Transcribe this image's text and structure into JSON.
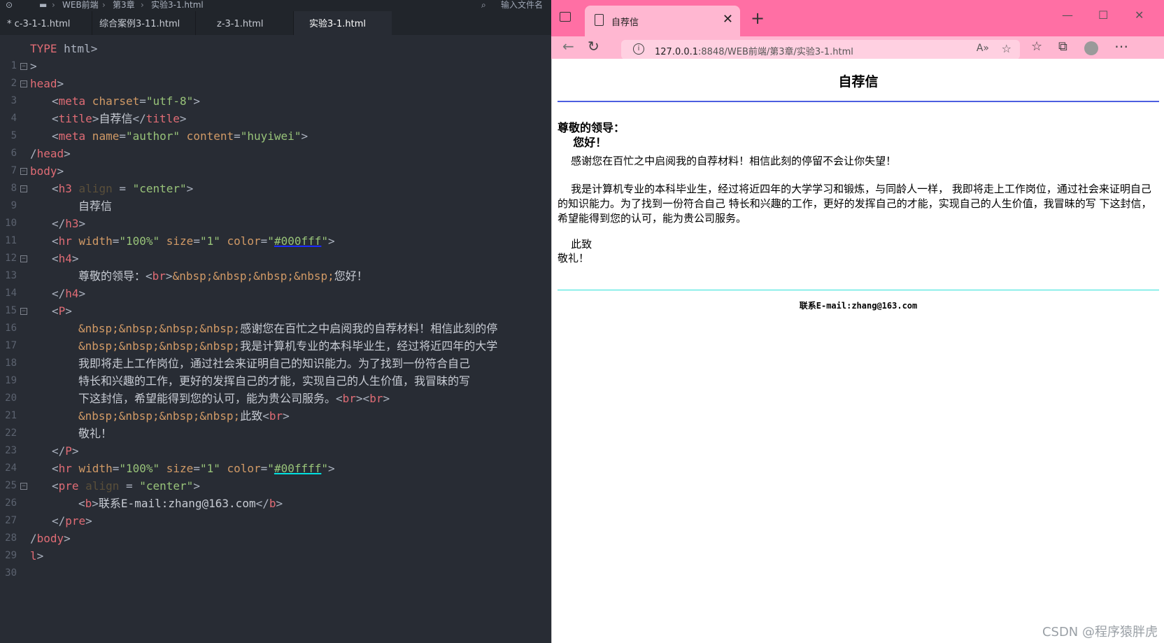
{
  "editor": {
    "breadcrumb": [
      "WEB前端",
      "第3章",
      "实验3-1.html"
    ],
    "search_placeholder": "输入文件名",
    "tabs": [
      {
        "label": "* c-3-1-1.html"
      },
      {
        "label": "综合案例3-11.html"
      },
      {
        "label": "z-3-1.html"
      },
      {
        "label": "实验3-1.html",
        "active": true
      }
    ],
    "line_numbers": [
      "1",
      "2",
      "3",
      "4",
      "5",
      "6",
      "7",
      "8",
      "9",
      "10",
      "11",
      "12",
      "13",
      "14",
      "15",
      "16",
      "17",
      "18",
      "19",
      "20",
      "21",
      "22",
      "23",
      "24",
      "25",
      "26",
      "27",
      "28",
      "29",
      "30"
    ],
    "lines": {
      "l1_a": "TYPE",
      "l1_b": " html>",
      "l2": ">",
      "l3_a": "head",
      "l3_b": ">",
      "l4_a": "<",
      "l4_b": "meta",
      "l4_c": " charset",
      "l4_d": "=",
      "l4_e": "\"utf-8\"",
      "l4_f": ">",
      "l5_a": "<",
      "l5_b": "title",
      "l5_c": ">",
      "l5_d": "自荐信",
      "l5_e": "</",
      "l5_f": "title",
      "l5_g": ">",
      "l6_a": "<",
      "l6_b": "meta",
      "l6_c": " name",
      "l6_d": "=",
      "l6_e": "\"author\"",
      "l6_f": " content",
      "l6_g": "=",
      "l6_h": "\"huyiwei\"",
      "l6_i": ">",
      "l7_a": "/",
      "l7_b": "head",
      "l7_c": ">",
      "l8_a": "body",
      "l8_b": ">",
      "l9_a": "<",
      "l9_b": "h3",
      "l9_c": " align",
      "l9_d": " = ",
      "l9_e": "\"center\"",
      "l9_f": ">",
      "l10": "自荐信",
      "l11_a": "</",
      "l11_b": "h3",
      "l11_c": ">",
      "l12_a": "<",
      "l12_b": "hr",
      "l12_c": " width",
      "l12_d": "=",
      "l12_e": "\"100%\"",
      "l12_f": " size",
      "l12_g": "=",
      "l12_h": "\"1\"",
      "l12_i": " color",
      "l12_j": "=",
      "l12_k": "\"",
      "l12_l": "#000fff",
      "l12_m": "\"",
      "l12_n": ">",
      "l13_a": "<",
      "l13_b": "h4",
      "l13_c": ">",
      "l14_a": "尊敬的领导：",
      "l14_b": "<",
      "l14_c": "br",
      "l14_d": ">",
      "l14_e": "&nbsp;&nbsp;&nbsp;&nbsp;",
      "l14_f": "您好！",
      "l15_a": "</",
      "l15_b": "h4",
      "l15_c": ">",
      "l16_a": "<",
      "l16_b": "P",
      "l16_c": ">",
      "l17_a": "&nbsp;&nbsp;&nbsp;&nbsp;",
      "l17_b": "感谢您在百忙之中启阅我的自荐材料！相信此刻的停",
      "l18_a": "&nbsp;&nbsp;&nbsp;&nbsp;",
      "l18_b": "我是计算机专业的本科毕业生，经过将近四年的大学",
      "l19": "我即将走上工作岗位，通过社会来证明自己的知识能力。为了找到一份符合自己",
      "l20": "特长和兴趣的工作，更好的发挥自己的才能，实现自己的人生价值，我冒昧的写",
      "l21_a": "下这封信，希望能得到您的认可，能为贵公司服务。",
      "l21_b": "<",
      "l21_c": "br",
      "l21_d": "><",
      "l21_e": "br",
      "l21_f": ">",
      "l22_a": "&nbsp;&nbsp;&nbsp;&nbsp;",
      "l22_b": "此致",
      "l22_c": "<",
      "l22_d": "br",
      "l22_e": ">",
      "l23": "敬礼！",
      "l24_a": "</",
      "l24_b": "P",
      "l24_c": ">",
      "l25_a": "<",
      "l25_b": "hr",
      "l25_c": " width",
      "l25_d": "=",
      "l25_e": "\"100%\"",
      "l25_f": " size",
      "l25_g": "=",
      "l25_h": "\"1\"",
      "l25_i": " color",
      "l25_j": "=",
      "l25_k": "\"",
      "l25_l": "#00ffff",
      "l25_m": "\"",
      "l25_n": ">",
      "l26_a": "<",
      "l26_b": "pre",
      "l26_c": " align",
      "l26_d": " = ",
      "l26_e": "\"center\"",
      "l26_f": ">",
      "l27_a": "<",
      "l27_b": "b",
      "l27_c": ">",
      "l27_d": "联系E-mail:zhang@163.com",
      "l27_e": "</",
      "l27_f": "b",
      "l27_g": ">",
      "l28_a": "</",
      "l28_b": "pre",
      "l28_c": ">",
      "l29_a": "/",
      "l29_b": "body",
      "l29_c": ">",
      "l30_a": "l",
      "l30_b": ">"
    }
  },
  "browser": {
    "tab_title": "自荐信",
    "url_host": "127.0.0.1",
    "url_rest": ":8848/WEB前端/第3章/实验3-1.html",
    "page": {
      "heading": "自荐信",
      "greeting": "尊敬的领导：",
      "greeting2": "    您好！",
      "para1": "    感谢您在百忙之中启阅我的自荐材料！相信此刻的停留不会让你失望！",
      "para2": "    我是计算机专业的本科毕业生，经过将近四年的大学学习和锻炼，与同龄人一样， 我即将走上工作岗位，通过社会来证明自己的知识能力。为了找到一份符合自己 特长和兴趣的工作，更好的发挥自己的才能，实现自己的人生价值，我冒昧的写 下这封信，希望能得到您的认可，能为贵公司服务。",
      "closing": "    此致",
      "closing2": "敬礼！",
      "contact": "联系E-mail:zhang@163.com"
    }
  },
  "watermark": "CSDN @程序猿胖虎",
  "colors": {
    "titlebar": "#ff6fa4",
    "hr1": "#4c5fe0",
    "hr2": "#2fe2d9"
  }
}
